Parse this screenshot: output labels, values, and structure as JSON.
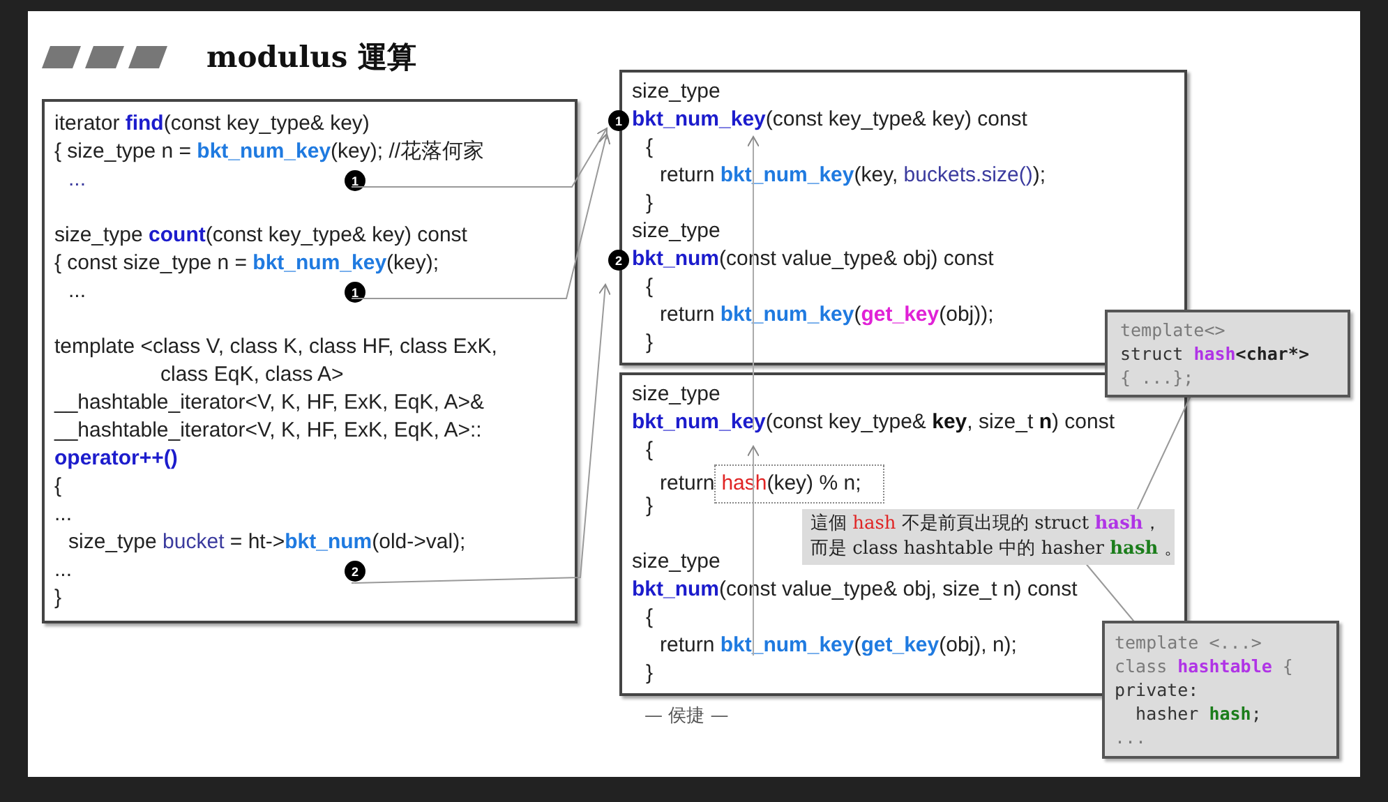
{
  "title": "modulus 運算",
  "left_box": {
    "lines": [
      {
        "kind": "top",
        "segments": [
          {
            "t": "iterator ",
            "kind": "plain"
          },
          {
            "t": "find",
            "kind": "def"
          },
          {
            "t": "(const key_type& key)",
            "kind": "plain"
          }
        ]
      },
      {
        "kind": "top",
        "segments": [
          {
            "t": "{ size_type n = ",
            "kind": "plain"
          },
          {
            "t": "bkt_num_key",
            "kind": "call"
          },
          {
            "t": "(key); //花落何家",
            "kind": "plain"
          }
        ]
      },
      {
        "kind": "inner",
        "segments": [
          {
            "t": "...",
            "kind": "var"
          }
        ],
        "badge": {
          "text": "1",
          "kind": "inline"
        }
      },
      {
        "kind": "blank"
      },
      {
        "kind": "top",
        "segments": [
          {
            "t": "size_type ",
            "kind": "plain"
          },
          {
            "t": "count",
            "kind": "def"
          },
          {
            "t": "(const key_type& key) const",
            "kind": "plain"
          }
        ]
      },
      {
        "kind": "top",
        "segments": [
          {
            "t": "{ const size_type n = ",
            "kind": "plain"
          },
          {
            "t": "bkt_num_key",
            "kind": "call"
          },
          {
            "t": "(key);",
            "kind": "plain"
          }
        ]
      },
      {
        "kind": "inner",
        "segments": [
          {
            "t": "...",
            "kind": "plain"
          }
        ],
        "badge": {
          "text": "1",
          "kind": "inline"
        }
      },
      {
        "kind": "blank"
      },
      {
        "kind": "top",
        "segments": [
          {
            "t": "template <class V, class K, class HF, class ExK,",
            "kind": "plain"
          }
        ]
      },
      {
        "kind": "deep",
        "segments": [
          {
            "t": "class EqK, class A>",
            "kind": "plain"
          }
        ]
      },
      {
        "kind": "top",
        "segments": [
          {
            "t": "__hashtable_iterator<V, K, HF, ExK, EqK, A>&",
            "kind": "plain"
          }
        ]
      },
      {
        "kind": "top",
        "segments": [
          {
            "t": "__hashtable_iterator<V, K, HF, ExK, EqK, A>::",
            "kind": "plain"
          }
        ]
      },
      {
        "kind": "top",
        "segments": [
          {
            "t": "operator++()",
            "kind": "def"
          }
        ]
      },
      {
        "kind": "top",
        "segments": [
          {
            "t": "{",
            "kind": "plain"
          }
        ]
      },
      {
        "kind": "top",
        "segments": [
          {
            "t": "...",
            "kind": "plain"
          }
        ]
      },
      {
        "kind": "inner",
        "segments": [
          {
            "t": "size_type ",
            "kind": "plain"
          },
          {
            "t": "bucket",
            "kind": "var"
          },
          {
            "t": " = ht->",
            "kind": "plain"
          },
          {
            "t": "bkt_num",
            "kind": "call"
          },
          {
            "t": "(old->val);",
            "kind": "plain"
          }
        ]
      },
      {
        "kind": "top",
        "segments": [
          {
            "t": "...",
            "kind": "plain"
          }
        ],
        "badge": {
          "text": "2",
          "kind": "inline"
        }
      },
      {
        "kind": "top",
        "segments": [
          {
            "t": "}",
            "kind": "plain"
          }
        ]
      }
    ]
  },
  "right_boxes": [
    {
      "lines": [
        {
          "kind": "top",
          "segments": [
            {
              "t": "size_type",
              "kind": "plain"
            }
          ]
        },
        {
          "kind": "top",
          "segments": [
            {
              "t": "bkt_num_key",
              "kind": "def"
            },
            {
              "t": "(const key_type& key) const",
              "kind": "plain"
            }
          ],
          "badge": {
            "text": "1",
            "kind": "edge"
          }
        },
        {
          "kind": "inner",
          "segments": [
            {
              "t": "{",
              "kind": "plain"
            }
          ]
        },
        {
          "kind": "deep2",
          "segments": [
            {
              "t": "return ",
              "kind": "plain"
            },
            {
              "t": "bkt_num_key",
              "kind": "call"
            },
            {
              "t": "(key, ",
              "kind": "plain"
            },
            {
              "t": "buckets.size()",
              "kind": "var"
            },
            {
              "t": ");",
              "kind": "plain"
            }
          ]
        },
        {
          "kind": "inner",
          "segments": [
            {
              "t": "}",
              "kind": "plain"
            }
          ]
        },
        {
          "kind": "top",
          "segments": [
            {
              "t": "size_type",
              "kind": "plain"
            }
          ]
        },
        {
          "kind": "top",
          "segments": [
            {
              "t": "bkt_num",
              "kind": "def"
            },
            {
              "t": "(const value_type& obj) const",
              "kind": "plain"
            }
          ],
          "badge": {
            "text": "2",
            "kind": "edge"
          }
        },
        {
          "kind": "inner",
          "segments": [
            {
              "t": "{",
              "kind": "plain"
            }
          ]
        },
        {
          "kind": "deep2",
          "segments": [
            {
              "t": "return ",
              "kind": "plain"
            },
            {
              "t": "bkt_num_key",
              "kind": "call"
            },
            {
              "t": "(",
              "kind": "plain"
            },
            {
              "t": "get_key",
              "kind": "magenta"
            },
            {
              "t": "(obj));",
              "kind": "plain"
            }
          ]
        },
        {
          "kind": "inner",
          "segments": [
            {
              "t": "}",
              "kind": "plain"
            }
          ]
        }
      ]
    },
    {
      "lines": [
        {
          "kind": "top",
          "segments": [
            {
              "t": "size_type",
              "kind": "plain"
            }
          ]
        },
        {
          "kind": "top",
          "segments": [
            {
              "t": "bkt_num_key",
              "kind": "def"
            },
            {
              "t": "(const key_type& ",
              "kind": "plain"
            },
            {
              "t": "key",
              "kind": "strong"
            },
            {
              "t": ", size_t ",
              "kind": "plain"
            },
            {
              "t": "n",
              "kind": "strong"
            },
            {
              "t": ") const",
              "kind": "plain"
            }
          ]
        },
        {
          "kind": "inner",
          "segments": [
            {
              "t": "{",
              "kind": "plain"
            }
          ]
        },
        {
          "kind": "deep2",
          "segments": [
            {
              "t": "return",
              "kind": "plain"
            },
            {
              "kind": "frame",
              "segments": [
                {
                  "t": "hash",
                  "kind": "red"
                },
                {
                  "t": "(key) % n;",
                  "kind": "plain"
                }
              ]
            }
          ]
        },
        {
          "kind": "inner",
          "segments": [
            {
              "t": "}",
              "kind": "plain"
            }
          ]
        },
        {
          "kind": "blank"
        },
        {
          "kind": "top",
          "segments": [
            {
              "t": "size_type",
              "kind": "plain"
            }
          ]
        },
        {
          "kind": "top",
          "segments": [
            {
              "t": "bkt_num",
              "kind": "def"
            },
            {
              "t": "(const value_type& obj, size_t n) const",
              "kind": "plain"
            }
          ]
        },
        {
          "kind": "inner",
          "segments": [
            {
              "t": "{",
              "kind": "plain"
            }
          ]
        },
        {
          "kind": "deep2",
          "segments": [
            {
              "t": "return ",
              "kind": "plain"
            },
            {
              "t": "bkt_num_key",
              "kind": "call"
            },
            {
              "t": "(",
              "kind": "plain"
            },
            {
              "t": "get_key",
              "kind": "call"
            },
            {
              "t": "(obj), n);",
              "kind": "plain"
            }
          ]
        },
        {
          "kind": "inner",
          "segments": [
            {
              "t": "}",
              "kind": "plain"
            }
          ]
        }
      ]
    }
  ],
  "author": "— 侯捷 —",
  "callouts": [
    {
      "kind": "code-top",
      "lines": [
        [
          {
            "t": "template<>",
            "kind": "gray"
          }
        ],
        [
          {
            "t": "struct ",
            "kind": "dark"
          },
          {
            "t": "hash",
            "kind": "purple"
          },
          {
            "t": "<char*>",
            "kind": "darkbold"
          }
        ],
        [
          {
            "t": "{ ...};",
            "kind": "gray"
          }
        ]
      ]
    },
    {
      "kind": "note",
      "lines": [
        [
          {
            "t": "這個 ",
            "kind": "plain"
          },
          {
            "t": "hash",
            "kind": "red"
          },
          {
            "t": " 不是前頁出現的 struct ",
            "kind": "plain"
          },
          {
            "t": "hash",
            "kind": "purple"
          },
          {
            "t": "，",
            "kind": "plain"
          }
        ],
        [
          {
            "t": "而是 class hashtable 中的 hasher ",
            "kind": "plain"
          },
          {
            "t": "hash",
            "kind": "green"
          },
          {
            "t": " 。",
            "kind": "plain"
          }
        ]
      ]
    },
    {
      "kind": "code-bottom",
      "lines": [
        [
          {
            "t": "template <...>",
            "kind": "gray"
          }
        ],
        [
          {
            "t": "class ",
            "kind": "gray"
          },
          {
            "t": "hashtable",
            "kind": "purple"
          },
          {
            "t": " {",
            "kind": "gray"
          }
        ],
        [
          {
            "t": "private:",
            "kind": "dark"
          }
        ],
        [
          {
            "t": "  hasher ",
            "kind": "dark"
          },
          {
            "t": "hash",
            "kind": "green"
          },
          {
            "t": ";",
            "kind": "dark"
          }
        ],
        [
          {
            "t": "...",
            "kind": "gray"
          }
        ]
      ]
    }
  ]
}
